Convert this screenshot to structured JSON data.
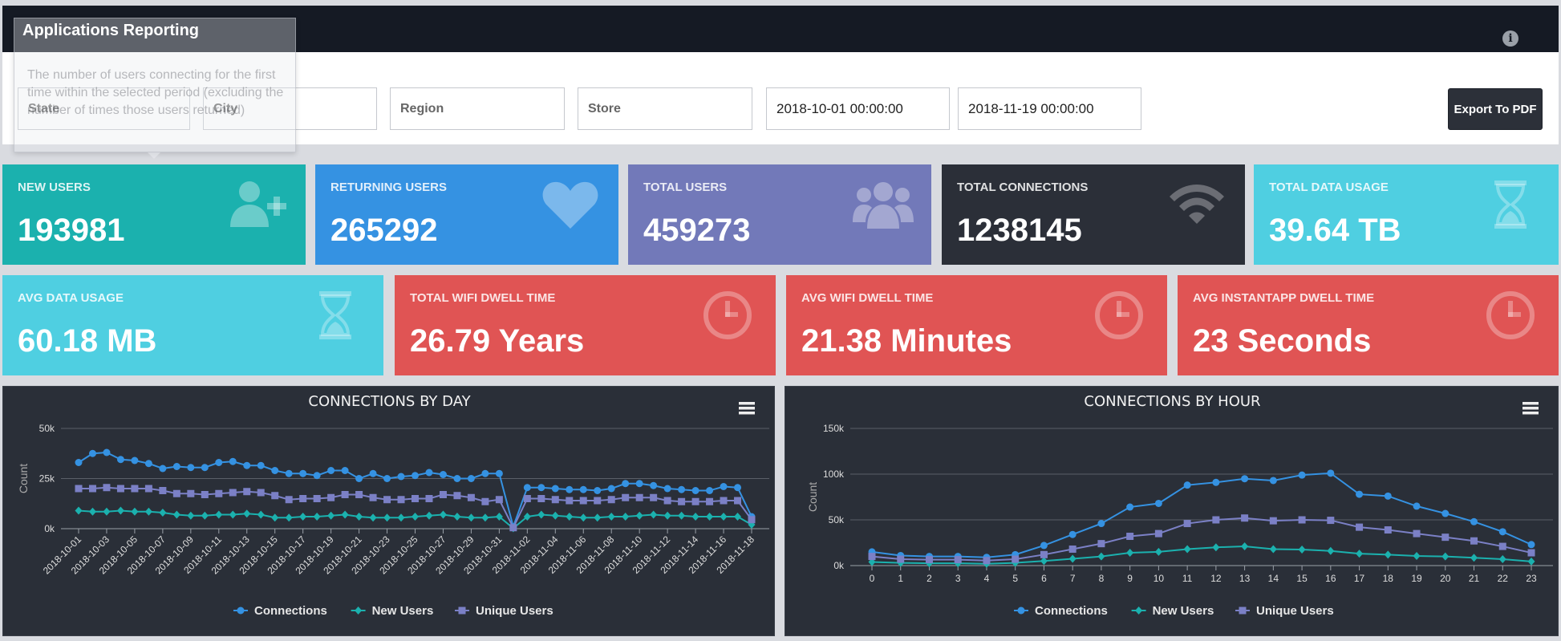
{
  "header": {
    "title": "Applications Reporting",
    "info_icon": "info-icon"
  },
  "tooltip": {
    "text": "The number of users connecting for the first time within the selected period (excluding the number of times those users returned)"
  },
  "filters": {
    "state_placeholder": "State",
    "city_placeholder": "City",
    "region_placeholder": "Region",
    "store_placeholder": "Store",
    "start_date": "2018-10-01 00:00:00",
    "end_date": "2018-11-19 00:00:00",
    "export_label": "Export To PDF"
  },
  "stats_row1": [
    {
      "label": "NEW USERS",
      "value": "193981",
      "color": "#1bb1ae",
      "icon": "user-plus-icon"
    },
    {
      "label": "RETURNING USERS",
      "value": "265292",
      "color": "#3592e2",
      "icon": "heart-icon"
    },
    {
      "label": "TOTAL USERS",
      "value": "459273",
      "color": "#7279b9",
      "icon": "users-icon"
    },
    {
      "label": "TOTAL CONNECTIONS",
      "value": "1238145",
      "color": "#2b2f38",
      "icon": "wifi-icon"
    },
    {
      "label": "TOTAL DATA USAGE",
      "value": "39.64 TB",
      "color": "#4fcfe1",
      "icon": "hourglass-icon"
    }
  ],
  "stats_row2": [
    {
      "label": "AVG DATA USAGE",
      "value": "60.18 MB",
      "color": "#4fcfe1",
      "icon": "hourglass-icon"
    },
    {
      "label": "TOTAL WIFI DWELL TIME",
      "value": "26.79 Years",
      "color": "#e05454",
      "icon": "clock-icon"
    },
    {
      "label": "AVG WIFI DWELL TIME",
      "value": "21.38 Minutes",
      "color": "#e05454",
      "icon": "clock-icon"
    },
    {
      "label": "AVG INSTANTAPP DWELL TIME",
      "value": "23 Seconds",
      "color": "#e05454",
      "icon": "clock-icon"
    }
  ],
  "chart_data": [
    {
      "type": "line",
      "title": "CONNECTIONS BY DAY",
      "xlabel": "",
      "ylabel": "Count",
      "ylim": [
        0,
        50000
      ],
      "yticks": [
        "0k",
        "25k",
        "50k"
      ],
      "x": [
        "2018-10-01",
        "2018-10-02",
        "2018-10-03",
        "2018-10-04",
        "2018-10-05",
        "2018-10-06",
        "2018-10-07",
        "2018-10-08",
        "2018-10-09",
        "2018-10-10",
        "2018-10-11",
        "2018-10-12",
        "2018-10-13",
        "2018-10-14",
        "2018-10-15",
        "2018-10-16",
        "2018-10-17",
        "2018-10-18",
        "2018-10-19",
        "2018-10-20",
        "2018-10-21",
        "2018-10-22",
        "2018-10-23",
        "2018-10-24",
        "2018-10-25",
        "2018-10-26",
        "2018-10-27",
        "2018-10-28",
        "2018-10-29",
        "2018-10-30",
        "2018-10-31",
        "2018-11-01",
        "2018-11-02",
        "2018-11-03",
        "2018-11-04",
        "2018-11-05",
        "2018-11-06",
        "2018-11-07",
        "2018-11-08",
        "2018-11-09",
        "2018-11-10",
        "2018-11-11",
        "2018-11-12",
        "2018-11-13",
        "2018-11-14",
        "2018-11-15",
        "2018-11-16",
        "2018-11-17",
        "2018-11-18"
      ],
      "x_tick_labels": [
        "2018-10-01",
        "2018-10-03",
        "2018-10-05",
        "2018-10-07",
        "2018-10-09",
        "2018-10-11",
        "2018-10-13",
        "2018-10-15",
        "2018-10-17",
        "2018-10-19",
        "2018-10-21",
        "2018-10-23",
        "2018-10-25",
        "2018-10-27",
        "2018-10-29",
        "2018-10-31",
        "2018-11-02",
        "2018-11-04",
        "2018-11-06",
        "2018-11-08",
        "2018-11-10",
        "2018-11-12",
        "2018-11-14",
        "2018-11-16",
        "2018-11-18"
      ],
      "series": [
        {
          "name": "Connections",
          "color": "#3592e2",
          "marker": "circle",
          "values": [
            33000,
            37500,
            38000,
            34500,
            34000,
            32500,
            30000,
            31000,
            30500,
            30500,
            33000,
            33500,
            31500,
            31500,
            29000,
            27500,
            27500,
            26500,
            29000,
            29000,
            25000,
            27500,
            25000,
            26000,
            26500,
            28000,
            27000,
            25000,
            25000,
            27500,
            27500,
            1000,
            20500,
            20500,
            20000,
            19500,
            19500,
            19000,
            20000,
            22500,
            22500,
            21500,
            20000,
            19500,
            19000,
            19000,
            21000,
            20500,
            6000
          ]
        },
        {
          "name": "New Users",
          "color": "#1bb1ae",
          "marker": "diamond",
          "values": [
            9000,
            8500,
            8500,
            9000,
            8500,
            8500,
            8000,
            7000,
            6500,
            6500,
            7000,
            7000,
            7500,
            7000,
            5500,
            5500,
            6000,
            6000,
            6500,
            7000,
            6000,
            5500,
            5500,
            5500,
            6000,
            6500,
            7000,
            6000,
            5500,
            5500,
            6000,
            200,
            6000,
            7000,
            6500,
            6000,
            5500,
            5500,
            6000,
            6000,
            6500,
            7000,
            6500,
            6500,
            6000,
            6000,
            6000,
            6000,
            2000
          ]
        },
        {
          "name": "Unique Users",
          "color": "#7b80c6",
          "marker": "square",
          "values": [
            20000,
            20000,
            20500,
            20000,
            20000,
            20000,
            19000,
            17500,
            17500,
            17000,
            17500,
            18000,
            18500,
            18000,
            16500,
            14500,
            15000,
            15000,
            15500,
            17000,
            17000,
            15500,
            14500,
            14500,
            15000,
            15000,
            17000,
            16500,
            15500,
            13500,
            14500,
            500,
            15000,
            15000,
            14500,
            14000,
            14000,
            14000,
            14500,
            15500,
            15500,
            15500,
            14000,
            13500,
            13500,
            13500,
            14000,
            14000,
            4500
          ]
        }
      ]
    },
    {
      "type": "line",
      "title": "CONNECTIONS BY HOUR",
      "xlabel": "",
      "ylabel": "Count",
      "ylim": [
        0,
        150000
      ],
      "yticks": [
        "0k",
        "50k",
        "100k",
        "150k"
      ],
      "x": [
        "0",
        "1",
        "2",
        "3",
        "4",
        "5",
        "6",
        "7",
        "8",
        "9",
        "10",
        "11",
        "12",
        "13",
        "14",
        "15",
        "16",
        "17",
        "18",
        "19",
        "20",
        "21",
        "22",
        "23"
      ],
      "series": [
        {
          "name": "Connections",
          "color": "#3592e2",
          "marker": "circle",
          "values": [
            15000,
            11000,
            10000,
            10000,
            9000,
            12000,
            22000,
            34000,
            46000,
            64000,
            68000,
            88000,
            91000,
            95000,
            93000,
            99000,
            101000,
            78000,
            76000,
            65000,
            57000,
            48000,
            37000,
            23000
          ]
        },
        {
          "name": "New Users",
          "color": "#1bb1ae",
          "marker": "diamond",
          "values": [
            4000,
            3000,
            2500,
            2500,
            2000,
            3000,
            5000,
            7500,
            10000,
            14000,
            15000,
            18000,
            20000,
            21000,
            18000,
            17500,
            16000,
            13000,
            12000,
            10500,
            10000,
            8500,
            7000,
            4500
          ]
        },
        {
          "name": "Unique Users",
          "color": "#7b80c6",
          "marker": "square",
          "values": [
            10000,
            7000,
            6500,
            6500,
            5500,
            7000,
            12000,
            18000,
            24000,
            32000,
            35000,
            46000,
            50000,
            52000,
            49000,
            50000,
            49500,
            42000,
            39000,
            35000,
            31000,
            27000,
            21000,
            14000
          ]
        }
      ]
    }
  ]
}
